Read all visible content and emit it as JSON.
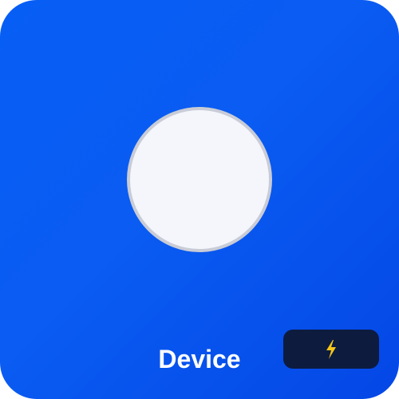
{
  "device": {
    "name": "Device",
    "badge_icon": "lightning-bolt-icon",
    "colors": {
      "tile": "#0a5cf2",
      "knob": "#f4f6fc",
      "knob_ring": "#c9ccd6",
      "badge": "#0d1b3f",
      "bolt": "#f5c518"
    }
  }
}
